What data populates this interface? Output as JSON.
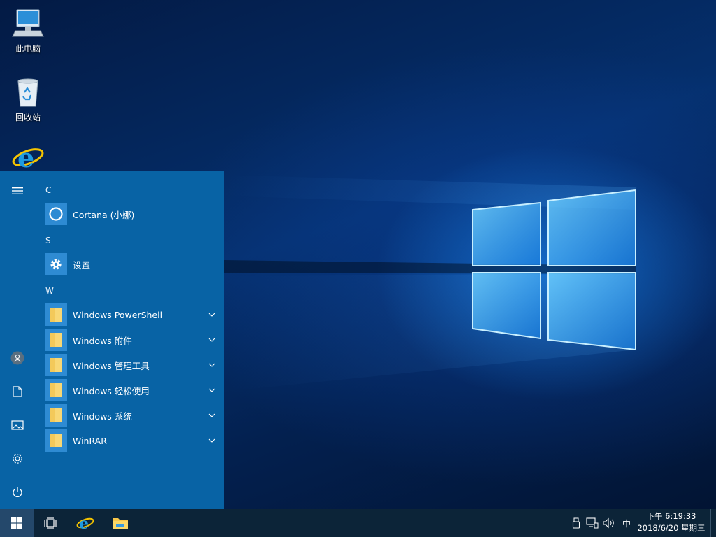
{
  "desktop": {
    "icons": [
      {
        "label": "此电脑",
        "icon": "computer-icon"
      },
      {
        "label": "回收站",
        "icon": "recycle-bin-icon"
      },
      {
        "label": "",
        "icon": "internet-explorer-icon"
      }
    ]
  },
  "start_menu": {
    "rail": {
      "items": [
        "hamburger-icon",
        "user-icon",
        "documents-icon",
        "pictures-icon",
        "settings-icon",
        "power-icon"
      ]
    },
    "sections": [
      {
        "letter": "C",
        "apps": [
          {
            "name": "Cortana (小娜)",
            "icon": "cortana-icon",
            "expandable": false
          }
        ]
      },
      {
        "letter": "S",
        "apps": [
          {
            "name": "设置",
            "icon": "gear-icon",
            "expandable": false
          }
        ]
      },
      {
        "letter": "W",
        "apps": [
          {
            "name": "Windows PowerShell",
            "icon": "folder-icon",
            "expandable": true
          },
          {
            "name": "Windows 附件",
            "icon": "folder-icon",
            "expandable": true
          },
          {
            "name": "Windows 管理工具",
            "icon": "folder-icon",
            "expandable": true
          },
          {
            "name": "Windows 轻松使用",
            "icon": "folder-icon",
            "expandable": true
          },
          {
            "name": "Windows 系统",
            "icon": "folder-icon",
            "expandable": true
          },
          {
            "name": "WinRAR",
            "icon": "folder-icon",
            "expandable": true
          }
        ]
      }
    ]
  },
  "taskbar": {
    "pinned": [
      "windows-start-icon",
      "task-view-icon",
      "internet-explorer-icon",
      "file-explorer-icon"
    ],
    "tray": {
      "icons": [
        "usb-device-icon",
        "network-icon",
        "volume-icon"
      ],
      "ime": "中",
      "time": "下午 6:19:33",
      "date": "2018/6/20 星期三"
    }
  },
  "colors": {
    "start_menu_bg": "#0863a5",
    "tile_blue": "#2e8bd3",
    "taskbar_bg": "#0c2438",
    "folder_yellow": "#f8d775"
  }
}
